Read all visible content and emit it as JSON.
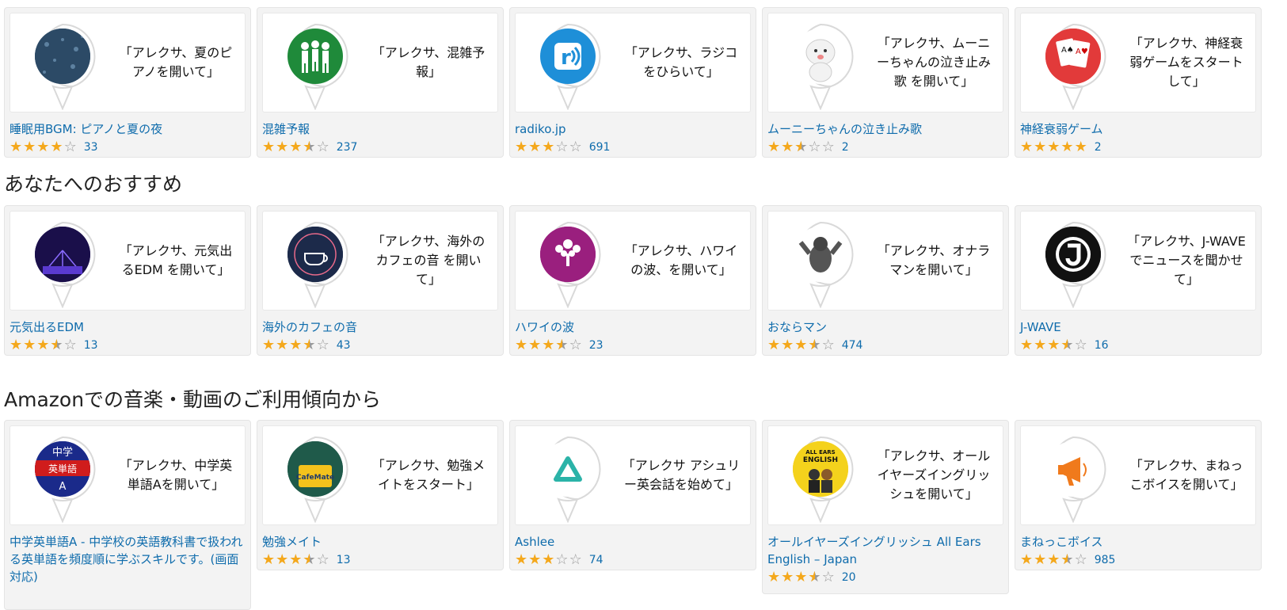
{
  "sections": [
    {
      "heading": "",
      "cards": [
        {
          "name": "睡眠用BGM: ピアノと夏の夜",
          "quote": "「アレクサ、夏のピアノを開いて」",
          "count": "33",
          "rating": 4.0,
          "icon": "rain-piano-icon",
          "icon_bg": "#2c4a66"
        },
        {
          "name": "混雑予報",
          "quote": "「アレクサ、混雑予報」",
          "count": "237",
          "rating": 3.5,
          "icon": "crowd-people-icon",
          "icon_bg": "#1f8a3a"
        },
        {
          "name": "radiko.jp",
          "quote": "「アレクサ、ラジコをひらいて」",
          "count": "691",
          "rating": 3.0,
          "icon": "radiko-r-icon",
          "icon_bg": "#1e8fd8"
        },
        {
          "name": "ムーニーちゃんの泣き止み歌",
          "quote": "「アレクサ、ムーニーちゃんの泣き止み歌 を開いて」",
          "count": "2",
          "rating": 2.5,
          "icon": "white-character-icon",
          "icon_bg": "#ffffff"
        },
        {
          "name": "神経衰弱ゲーム",
          "quote": "「アレクサ、神経衰弱ゲームをスタートして」",
          "count": "2",
          "rating": 5.0,
          "icon": "playing-cards-icon",
          "icon_bg": "#e23a3a"
        }
      ]
    },
    {
      "heading": "あなたへのおすすめ",
      "cards": [
        {
          "name": "元気出るEDM",
          "quote": "「アレクサ、元気出るEDM を開いて」",
          "count": "13",
          "rating": 3.5,
          "icon": "concert-stage-icon",
          "icon_bg": "#2a1a6a"
        },
        {
          "name": "海外のカフェの音",
          "quote": "「アレクサ、海外のカフェの音 を開いて」",
          "count": "43",
          "rating": 3.5,
          "icon": "cafe-cup-icon",
          "icon_bg": "#1c2a4a"
        },
        {
          "name": "ハワイの波",
          "quote": "「アレクサ、ハワイの波、を開いて」",
          "count": "23",
          "rating": 3.5,
          "icon": "tree-icon",
          "icon_bg": "#9a1f7e"
        },
        {
          "name": "おならマン",
          "quote": "「アレクサ、オナラマンを開いて」",
          "count": "474",
          "rating": 3.5,
          "icon": "gorilla-icon",
          "icon_bg": "#ffffff"
        },
        {
          "name": "J-WAVE",
          "quote": "「アレクサ、J-WAVEでニュースを聞かせて」",
          "count": "16",
          "rating": 3.5,
          "icon": "j-wave-logo-icon",
          "icon_bg": "#111111"
        }
      ]
    },
    {
      "heading": "Amazonでの音楽・動画のご利用傾向から",
      "cards": [
        {
          "name": "中学英単語A - 中学校の英語教科書で扱われる英単語を頻度順に学ぶスキルです。(画面対応)",
          "quote": "「アレクサ、中学英単語Aを開いて」",
          "count": "",
          "rating": 0,
          "icon": "english-words-icon",
          "icon_bg": "#1a2a8a",
          "icon_text1": "中学",
          "icon_text2": "英単語",
          "icon_text3": "A"
        },
        {
          "name": "勉強メイト",
          "quote": "「アレクサ、勉強メイトをスタート」",
          "count": "13",
          "rating": 3.5,
          "icon": "coffee-mate-icon",
          "icon_bg": "#1f5a4a",
          "icon_text1": "CafeMate"
        },
        {
          "name": "Ashlee",
          "quote": "「アレクサ アシュリー英会話を始めて」",
          "count": "74",
          "rating": 3.0,
          "icon": "triangle-logo-icon",
          "icon_bg": "#ffffff"
        },
        {
          "name": "オールイヤーズイングリッシュ All Ears English – Japan",
          "quote": "「アレクサ、オールイヤーズイングリッシュを開いて」",
          "count": "20",
          "rating": 3.5,
          "icon": "all-ears-english-icon",
          "icon_bg": "#f4d21c",
          "icon_text1": "ALL EARS",
          "icon_text2": "ENGLISH"
        },
        {
          "name": "まねっこボイス",
          "quote": "「アレクサ、まねっこボイスを開いて」",
          "count": "985",
          "rating": 3.5,
          "icon": "megaphone-icon",
          "icon_bg": "#ffffff"
        }
      ]
    }
  ]
}
